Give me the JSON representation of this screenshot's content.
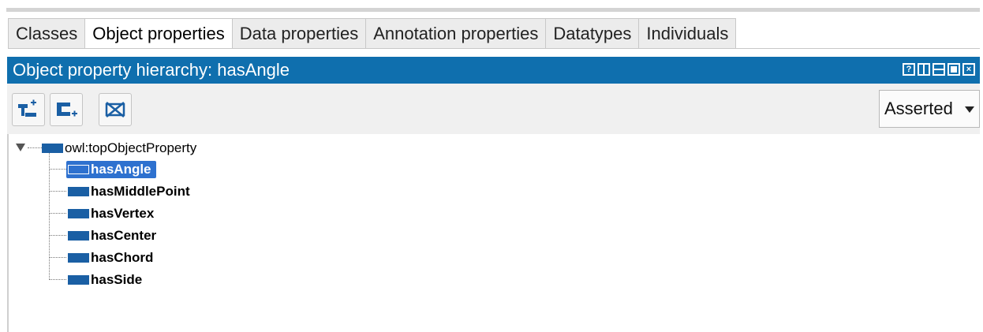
{
  "tabs": [
    {
      "label": "Classes"
    },
    {
      "label": "Object properties",
      "active": true
    },
    {
      "label": "Data properties"
    },
    {
      "label": "Annotation properties"
    },
    {
      "label": "Datatypes"
    },
    {
      "label": "Individuals"
    }
  ],
  "view": {
    "title": "Object property hierarchy: hasAngle",
    "controls": [
      "help-icon",
      "split-vertical-icon",
      "split-horizontal-icon",
      "maximize-icon",
      "close-icon"
    ]
  },
  "toolbar": {
    "buttons": [
      "add-subproperty-icon",
      "add-sibling-property-icon",
      "delete-property-icon"
    ],
    "mode_select": "Asserted"
  },
  "tree": {
    "root": "owl:topObjectProperty",
    "children": [
      "hasAngle",
      "hasMiddlePoint",
      "hasVertex",
      "hasCenter",
      "hasChord",
      "hasSide"
    ],
    "selected": "hasAngle"
  },
  "colors": {
    "header": "#0f6fae",
    "selection": "#2e71cf",
    "property_icon": "#1a5fa4"
  }
}
